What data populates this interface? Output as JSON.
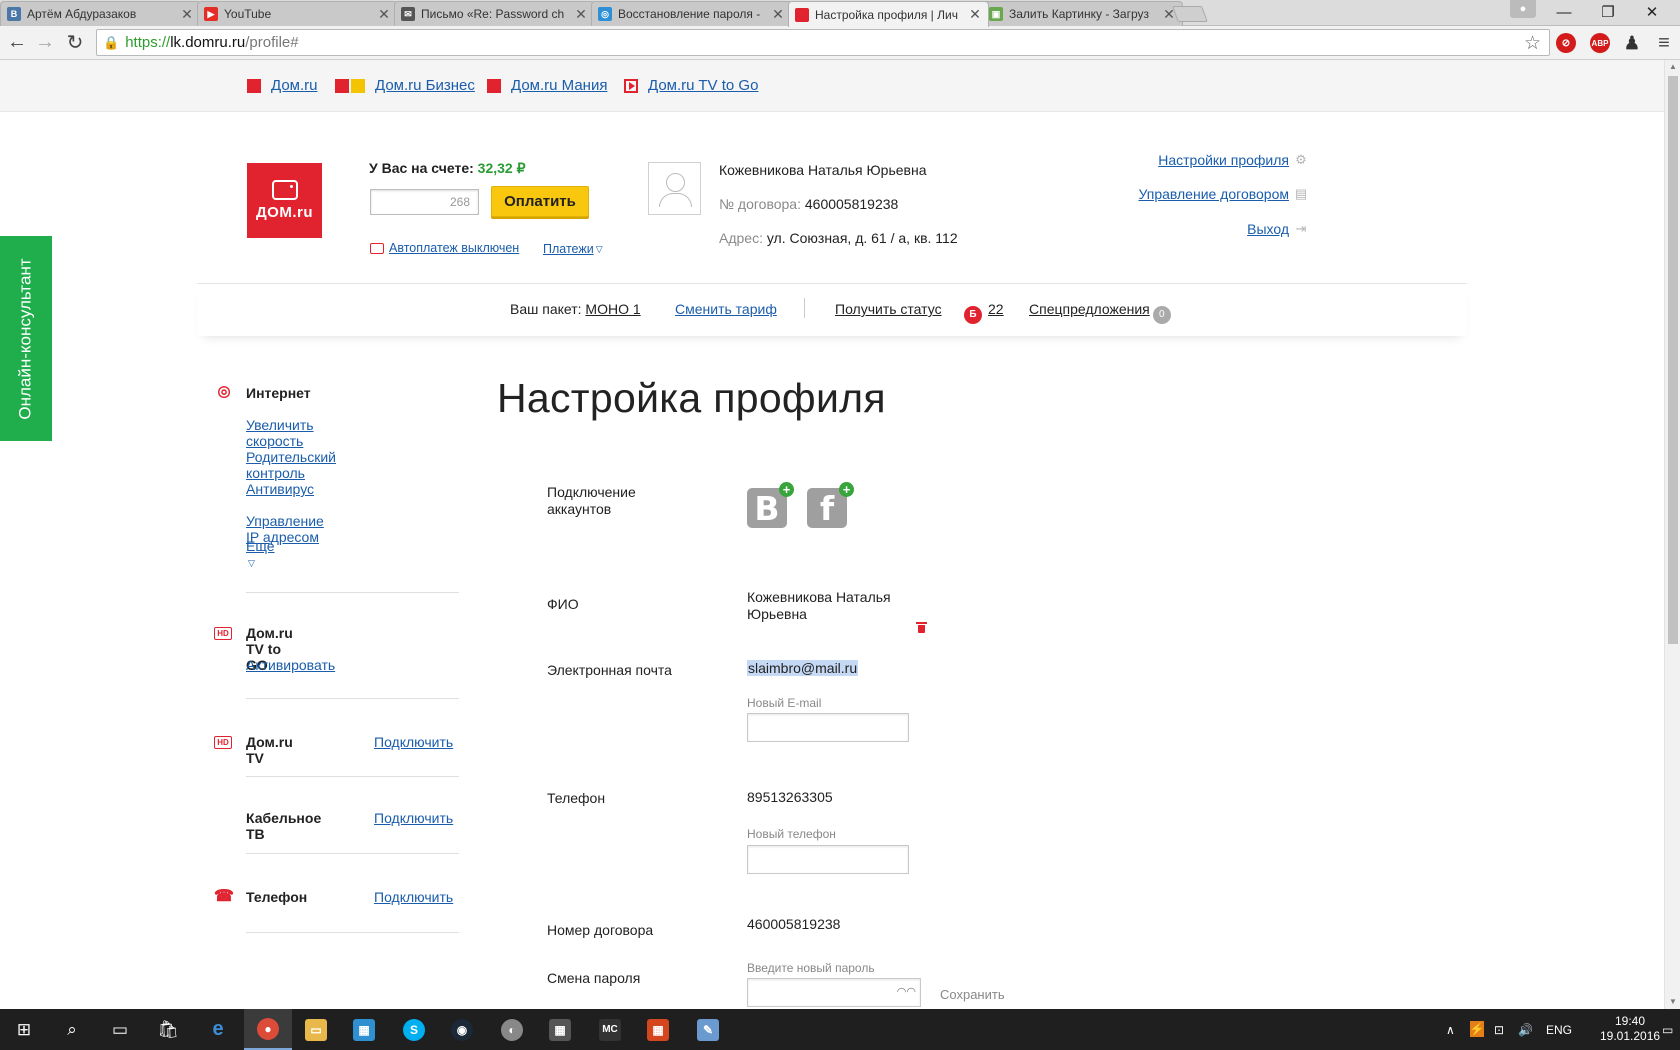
{
  "browser": {
    "tabs": [
      {
        "title": "Артём Абдуразаков",
        "favicon": "vk-icon",
        "color": "#4a76a8",
        "glyph": "В",
        "active": false
      },
      {
        "title": "YouTube",
        "favicon": "youtube-icon",
        "color": "#e52d27",
        "glyph": "▶",
        "active": false
      },
      {
        "title": "Письмо «Re: Password ch",
        "favicon": "mail-icon",
        "color": "#555555",
        "glyph": "✉",
        "active": false
      },
      {
        "title": "Восстановление пароля -",
        "favicon": "recovery-icon",
        "color": "#2d8fd5",
        "glyph": "◎",
        "active": false
      },
      {
        "title": "Настройка профиля | Лич",
        "favicon": "domru-icon",
        "color": "#e0232f",
        "glyph": "■",
        "active": true
      },
      {
        "title": "Залить Картинку - Загруз",
        "favicon": "image-host-icon",
        "color": "#6aa84f",
        "glyph": "▣",
        "active": false
      }
    ],
    "url_scheme": "https://",
    "url_host": "lk.domru.ru",
    "url_path": "/profile#"
  },
  "topnav": {
    "links": [
      "Дом.ru",
      "Дом.ru Бизнес",
      "Дом.ru Мания",
      "Дом.ru TV to Go"
    ]
  },
  "header": {
    "logo_text": "ДОМ.ru",
    "balance_label": "У Вас на счете:",
    "balance_value": "32,32 ₽",
    "amount_placeholder": "268",
    "pay_button": "Оплатить",
    "autopay": "Автоплатеж выключен",
    "payments": "Платежи",
    "user_name": "Кожевникова Наталья Юрьевна",
    "contract_label": "№ договора:",
    "contract_value": "460005819238",
    "address_label": "Адрес:",
    "address_value": "ул. Союзная, д. 61 / а, кв. 112",
    "profile_settings": "Настройки профиля",
    "manage_contract": "Управление договором",
    "logout": "Выход"
  },
  "package_bar": {
    "package_label": "Ваш пакет:",
    "package_value": "МОНО 1",
    "change_tariff": "Сменить тариф",
    "get_status": "Получить статус",
    "bonus_badge": "Б",
    "bonus_value": "22",
    "special_offers": "Спецпредложения",
    "special_count": "0"
  },
  "consultant": "Онлайн-консультант",
  "sidebar": {
    "internet": {
      "title": "Интернет",
      "links": [
        "Увеличить скорость",
        "Родительский контроль",
        "Антивирус",
        "Управление IP адресом"
      ],
      "more": "Еще"
    },
    "tvtogo": {
      "title": "Дом.ru TV to GO",
      "link": "Активировать"
    },
    "domrutv": {
      "title": "Дом.ru TV",
      "action": "Подключить"
    },
    "cabletv": {
      "title": "Кабельное ТВ",
      "action": "Подключить"
    },
    "phone": {
      "title": "Телефон",
      "action": "Подключить"
    }
  },
  "main": {
    "title": "Настройка профиля",
    "accounts_label_1": "Подключение",
    "accounts_label_2": "аккаунтов",
    "vk_glyph": "B",
    "fb_glyph": "f",
    "fio_label": "ФИО",
    "fio_value_1": "Кожевникова Наталья",
    "fio_value_2": "Юрьевна",
    "email_label": "Электронная почта",
    "email_value": "slaimbro@mail.ru",
    "new_email_label": "Новый E-mail",
    "phone_label": "Телефон",
    "phone_value": "89513263305",
    "new_phone_label": "Новый телефон",
    "contract_label": "Номер договора",
    "contract_value": "460005819238",
    "password_label": "Смена пароля",
    "new_password_label": "Введите новый пароль",
    "save": "Сохранить"
  },
  "taskbar": {
    "lang": "ENG",
    "time": "19:40",
    "date": "19.01.2016"
  }
}
